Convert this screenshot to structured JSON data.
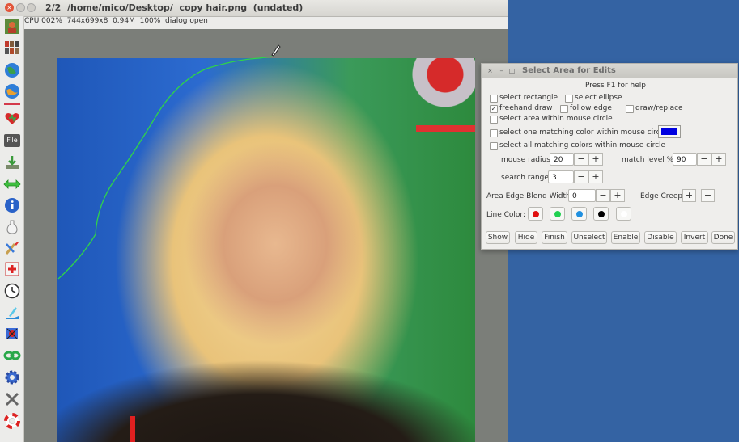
{
  "window": {
    "title": "2/2  /home/mico/Desktop/  copy hair.png  (undated)",
    "status": "CPU 002%  744x699x8  0.94M  100%  dialog open"
  },
  "toolbar": {
    "icons": [
      "image-thumbnail-icon",
      "gallery-icon",
      "globe-icon",
      "globe-alt-icon",
      "separator",
      "heart-icon",
      "file-icon",
      "download-icon",
      "resize-arrows-icon",
      "info-icon",
      "bottle-icon",
      "brush-icon",
      "add-icon",
      "clock-icon",
      "paint-icon",
      "spider-icon",
      "chain-icon",
      "gear-icon",
      "tools-icon",
      "lifebuoy-icon"
    ],
    "file_label": "File"
  },
  "dialog": {
    "title": "Select Area for Edits",
    "help": "Press F1 for help",
    "options": {
      "select_rectangle": {
        "label": "select rectangle",
        "checked": false
      },
      "select_ellipse": {
        "label": "select ellipse",
        "checked": false
      },
      "freehand_draw": {
        "label": "freehand draw",
        "checked": true
      },
      "follow_edge": {
        "label": "follow edge",
        "checked": false
      },
      "draw_replace": {
        "label": "draw/replace",
        "checked": false
      },
      "select_area_circle": {
        "label": "select area within mouse circle",
        "checked": false
      },
      "select_one_color": {
        "label": "select one matching color within mouse circle:",
        "checked": false
      },
      "select_all_colors": {
        "label": "select all matching colors within mouse circle",
        "checked": false
      }
    },
    "match_color": "#0000e0",
    "mouse_radius": {
      "label": "mouse radius",
      "value": "20"
    },
    "match_level": {
      "label": "match level %",
      "value": "90"
    },
    "search_range": {
      "label": "search range",
      "value": "3"
    },
    "blend_width": {
      "label": "Area Edge Blend Width",
      "value": "0"
    },
    "edge_creep": {
      "label": "Edge Creep"
    },
    "line_color": {
      "label": "Line Color:",
      "colors": [
        "#e01010",
        "#20d050",
        "#2090e0",
        "#000000",
        "#ffffff"
      ]
    },
    "buttons": {
      "show": "Show",
      "hide": "Hide",
      "finish": "Finish",
      "unselect": "Unselect",
      "enable": "Enable",
      "disable": "Disable",
      "invert": "Invert",
      "done": "Done"
    },
    "plus": "+",
    "minus": "−"
  }
}
